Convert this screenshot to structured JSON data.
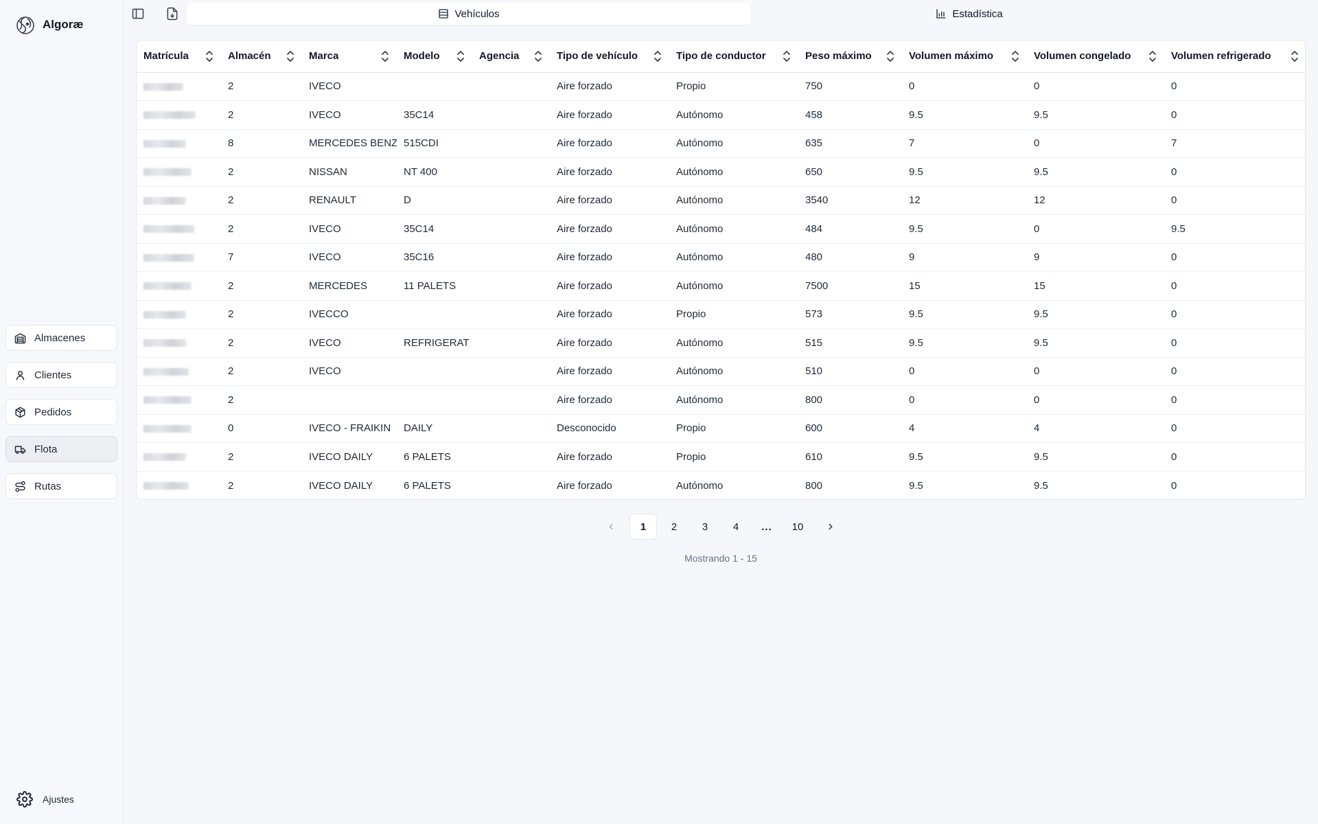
{
  "app": {
    "name": "Algoræ"
  },
  "sidebar": {
    "items": [
      {
        "label": "Almacenes",
        "icon": "warehouse-icon"
      },
      {
        "label": "Clientes",
        "icon": "user-icon"
      },
      {
        "label": "Pedidos",
        "icon": "package-icon"
      },
      {
        "label": "Flota",
        "icon": "truck-icon",
        "active": true
      },
      {
        "label": "Rutas",
        "icon": "route-icon"
      }
    ],
    "settings_label": "Ajustes"
  },
  "tabs": [
    {
      "label": "Vehículos",
      "icon": "table-icon",
      "active": true
    },
    {
      "label": "Estadística",
      "icon": "bar-chart-icon",
      "active": false
    }
  ],
  "table": {
    "columns": [
      "Matrícula",
      "Almacén",
      "Marca",
      "Modelo",
      "Agencia",
      "Tipo de vehículo",
      "Tipo de conductor",
      "Peso máximo",
      "Volumen máximo",
      "Volumen congelado",
      "Volumen refrigerado"
    ],
    "rows": [
      [
        "",
        "2",
        "IVECO",
        "",
        "",
        "Aire forzado",
        "Propio",
        "750",
        "0",
        "0",
        "0"
      ],
      [
        "",
        "2",
        "IVECO",
        "35C14",
        "",
        "Aire forzado",
        "Autónomo",
        "458",
        "9.5",
        "9.5",
        "0"
      ],
      [
        "",
        "8",
        "MERCEDES BENZ",
        "515CDI",
        "",
        "Aire forzado",
        "Autónomo",
        "635",
        "7",
        "0",
        "7"
      ],
      [
        "",
        "2",
        "NISSAN",
        "NT 400",
        "",
        "Aire forzado",
        "Autónomo",
        "650",
        "9.5",
        "9.5",
        "0"
      ],
      [
        "",
        "2",
        "RENAULT",
        "D",
        "",
        "Aire forzado",
        "Autónomo",
        "3540",
        "12",
        "12",
        "0"
      ],
      [
        "",
        "2",
        "IVECO",
        "35C14",
        "",
        "Aire forzado",
        "Autónomo",
        "484",
        "9.5",
        "0",
        "9.5"
      ],
      [
        "",
        "7",
        "IVECO",
        "35C16",
        "",
        "Aire forzado",
        "Autónomo",
        "480",
        "9",
        "9",
        "0"
      ],
      [
        "",
        "2",
        "MERCEDES",
        "11 PALETS",
        "",
        "Aire forzado",
        "Autónomo",
        "7500",
        "15",
        "15",
        "0"
      ],
      [
        "",
        "2",
        "IVECCO",
        "",
        "",
        "Aire forzado",
        "Propio",
        "573",
        "9.5",
        "9.5",
        "0"
      ],
      [
        "",
        "2",
        "IVECO",
        "REFRIGERAT",
        "",
        "Aire forzado",
        "Autónomo",
        "515",
        "9.5",
        "9.5",
        "0"
      ],
      [
        "",
        "2",
        "IVECO",
        "",
        "",
        "Aire forzado",
        "Autónomo",
        "510",
        "0",
        "0",
        "0"
      ],
      [
        "",
        "2",
        "",
        "",
        "",
        "Aire forzado",
        "Autónomo",
        "800",
        "0",
        "0",
        "0"
      ],
      [
        "",
        "0",
        "IVECO - FRAIKIN",
        "DAILY",
        "",
        "Desconocido",
        "Propio",
        "600",
        "4",
        "4",
        "0"
      ],
      [
        "",
        "2",
        "IVECO DAILY",
        "6 PALETS",
        "",
        "Aire forzado",
        "Propio",
        "610",
        "9.5",
        "9.5",
        "0"
      ],
      [
        "",
        "2",
        "IVECO DAILY",
        "6 PALETS",
        "",
        "Aire forzado",
        "Autónomo",
        "800",
        "9.5",
        "9.5",
        "0"
      ]
    ]
  },
  "pagination": {
    "pages": [
      "1",
      "2",
      "3",
      "4",
      "...",
      "10"
    ],
    "current": "1",
    "showing": "Mostrando 1 - 15"
  }
}
